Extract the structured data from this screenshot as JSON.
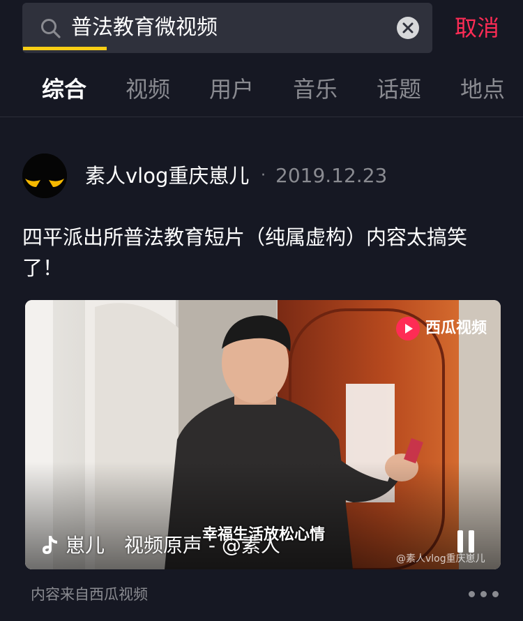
{
  "search": {
    "query": "普法教育微视频",
    "cancel_label": "取消"
  },
  "tabs": [
    {
      "label": "综合",
      "active": true
    },
    {
      "label": "视频",
      "active": false
    },
    {
      "label": "用户",
      "active": false
    },
    {
      "label": "音乐",
      "active": false
    },
    {
      "label": "话题",
      "active": false
    },
    {
      "label": "地点",
      "active": false
    }
  ],
  "post": {
    "author": "素人vlog重庆崽儿",
    "separator": "·",
    "date": "2019.12.23",
    "description": "四平派出所普法教育短片（纯属虚构）内容太搞笑了！",
    "video": {
      "brand_logo_text": "西瓜视频",
      "subtitle": "幸福生活放松心情",
      "music": "崽儿　视频原声 - @素人",
      "watermark": "@素人vlog重庆崽儿"
    },
    "source": "内容来自西瓜视频"
  },
  "colors": {
    "background": "#161823",
    "accent_red": "#fe2c55",
    "tab_indicator": "#face15",
    "muted_text": "#8a8b91"
  },
  "icons": [
    "search-icon",
    "clear-icon",
    "music-note-icon",
    "pause-icon",
    "more-icon",
    "xigua-logo-icon"
  ]
}
